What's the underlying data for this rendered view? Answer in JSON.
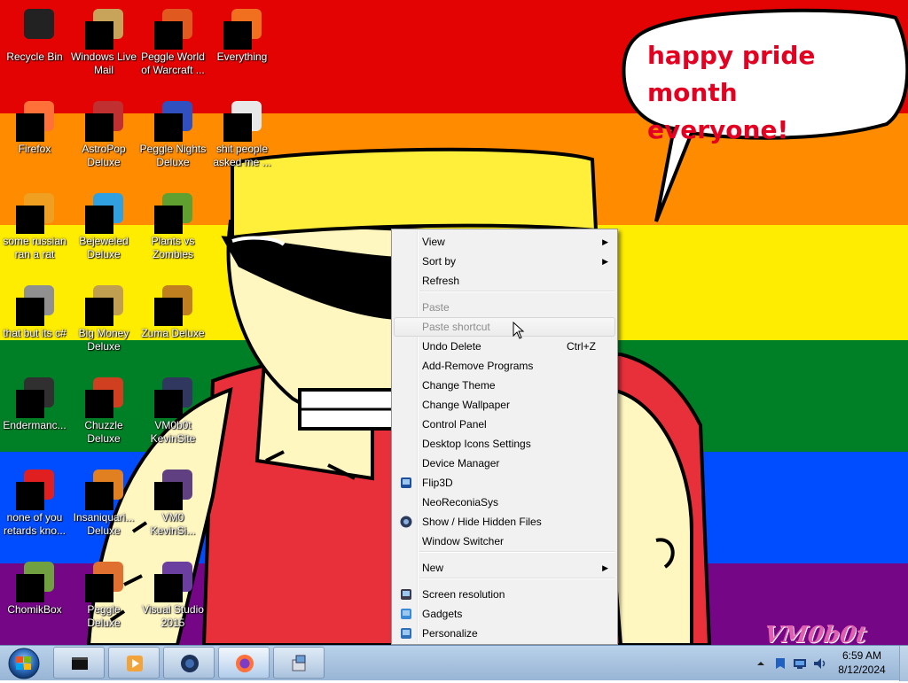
{
  "wallpaper": {
    "speech_bubble_text": "happy pride month\neveryone!",
    "signature": "VM0b0t",
    "stripe_colors": [
      "#e40303",
      "#ff8c00",
      "#ffed00",
      "#008026",
      "#004dff",
      "#750787"
    ]
  },
  "desktop_icons": [
    {
      "label": "Recycle Bin",
      "icon": "recycle-bin-icon",
      "color": "#222222"
    },
    {
      "label": "Windows Live Mail",
      "icon": "mail-icon",
      "color": "#c8a45a"
    },
    {
      "label": "Peggle World of Warcraft ...",
      "icon": "peggle-icon",
      "color": "#e05a20"
    },
    {
      "label": "Everything",
      "icon": "search-icon",
      "color": "#f07020"
    },
    {
      "label": "Firefox",
      "icon": "firefox-icon",
      "color": "#ff7139"
    },
    {
      "label": "AstroPop Deluxe",
      "icon": "game-icon",
      "color": "#c03030"
    },
    {
      "label": "Peggle Nights Deluxe",
      "icon": "peggle-icon",
      "color": "#3050c0"
    },
    {
      "label": "shit people asked me ...",
      "icon": "folder-icon",
      "color": "#e8e8e8"
    },
    {
      "label": "some russian ran a rat",
      "icon": "file-icon",
      "color": "#f0a020"
    },
    {
      "label": "Bejeweled Deluxe",
      "icon": "gem-icon",
      "color": "#30a0e0"
    },
    {
      "label": "Plants vs Zombies",
      "icon": "plant-icon",
      "color": "#60a030"
    },
    {
      "label": "that but its c#",
      "icon": "stack-icon",
      "color": "#909090"
    },
    {
      "label": "Big Money Deluxe",
      "icon": "money-icon",
      "color": "#c0a050"
    },
    {
      "label": "Zuma Deluxe",
      "icon": "zuma-icon",
      "color": "#c08020"
    },
    {
      "label": "Endermanc...",
      "icon": "terminal-icon",
      "color": "#303030"
    },
    {
      "label": "Chuzzle Deluxe",
      "icon": "chuzzle-icon",
      "color": "#d04020"
    },
    {
      "label": "VM0b0t KevinSite",
      "icon": "page-icon",
      "color": "#303860"
    },
    {
      "label": "none of you retards kno...",
      "icon": "opera-icon",
      "color": "#e02020"
    },
    {
      "label": "Insaniquari... Deluxe",
      "icon": "fish-icon",
      "color": "#e08020"
    },
    {
      "label": "VM0 KevinSi...",
      "icon": "page-icon",
      "color": "#604080"
    },
    {
      "label": "ChomikBox",
      "icon": "hamster-icon",
      "color": "#70a040"
    },
    {
      "label": "Peggle Deluxe",
      "icon": "peggle-icon",
      "color": "#e07030"
    },
    {
      "label": "Visual Studio 2015",
      "icon": "visual-studio-icon",
      "color": "#6a3fa0"
    }
  ],
  "context_menu": {
    "items": [
      {
        "label": "View",
        "submenu": "▶"
      },
      {
        "label": "Sort by",
        "submenu": "▶"
      },
      {
        "label": "Refresh"
      },
      {
        "label": "Paste",
        "disabled": true
      },
      {
        "label": "Paste shortcut",
        "disabled": true,
        "hover": true
      },
      {
        "label": "Undo Delete",
        "shortcut": "Ctrl+Z"
      },
      {
        "label": "Add-Remove Programs"
      },
      {
        "label": "Change Theme"
      },
      {
        "label": "Change Wallpaper"
      },
      {
        "label": "Control Panel"
      },
      {
        "label": "Desktop Icons Settings"
      },
      {
        "label": "Device Manager"
      },
      {
        "label": "Flip3D",
        "icon": "flip3d-icon"
      },
      {
        "label": "NeoReconiaSys"
      },
      {
        "label": "Show / Hide Hidden Files",
        "icon": "globe-icon"
      },
      {
        "label": "Window Switcher"
      },
      {
        "label": "New",
        "submenu": "▶"
      },
      {
        "label": "Screen resolution",
        "icon": "monitor-icon"
      },
      {
        "label": "Gadgets",
        "icon": "gadgets-icon"
      },
      {
        "label": "Personalize",
        "icon": "personalize-icon"
      }
    ]
  },
  "taskbar": {
    "start_icon": "windows-start-icon",
    "buttons": [
      {
        "icon": "black-box-icon"
      },
      {
        "icon": "media-player-icon"
      },
      {
        "icon": "globe-icon"
      },
      {
        "icon": "firefox-icon"
      },
      {
        "icon": "installer-icon"
      }
    ],
    "tray_icons": [
      "show-hidden-icons-chevron",
      "action-center-icon",
      "network-icon",
      "volume-icon"
    ],
    "clock": {
      "time": "6:59 AM",
      "date": "8/12/2024"
    }
  }
}
